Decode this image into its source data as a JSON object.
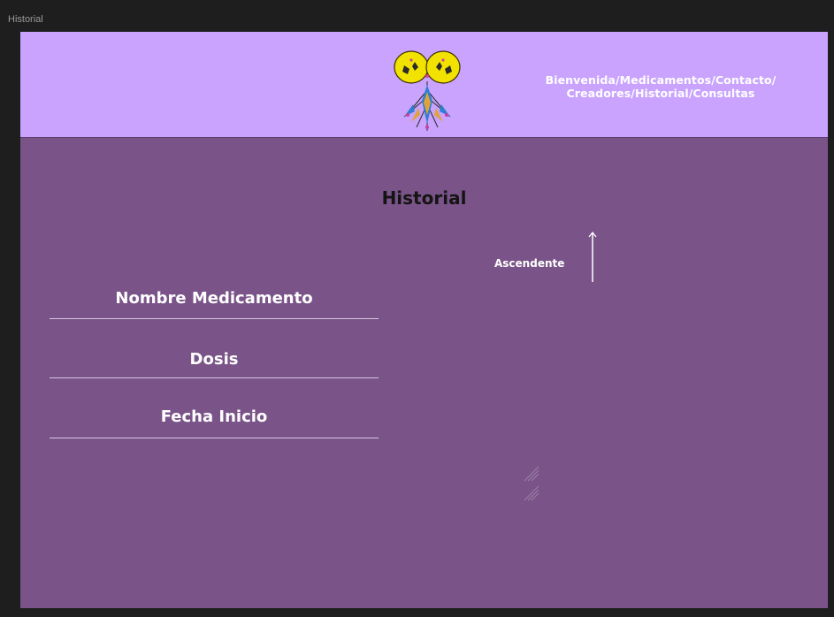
{
  "window": {
    "frame_title": "Historial"
  },
  "header": {
    "nav_line_1": "Bienvenida/Medicamentos/Contacto/",
    "nav_line_2": "Creadores/Historial/Consultas",
    "logo_icon": "yellow-heart-flower-logo"
  },
  "main": {
    "title": "Historial",
    "sort": {
      "label": "Ascendente",
      "icon": "arrow-up-icon"
    },
    "fields": [
      {
        "label": "Nombre Medicamento"
      },
      {
        "label": "Dosis"
      },
      {
        "label": "Fecha Inicio"
      }
    ]
  },
  "colors": {
    "header_bg": "#c9a3fe",
    "body_bg": "#7a5488",
    "title_text": "#141414",
    "label_text": "#ffffff"
  }
}
